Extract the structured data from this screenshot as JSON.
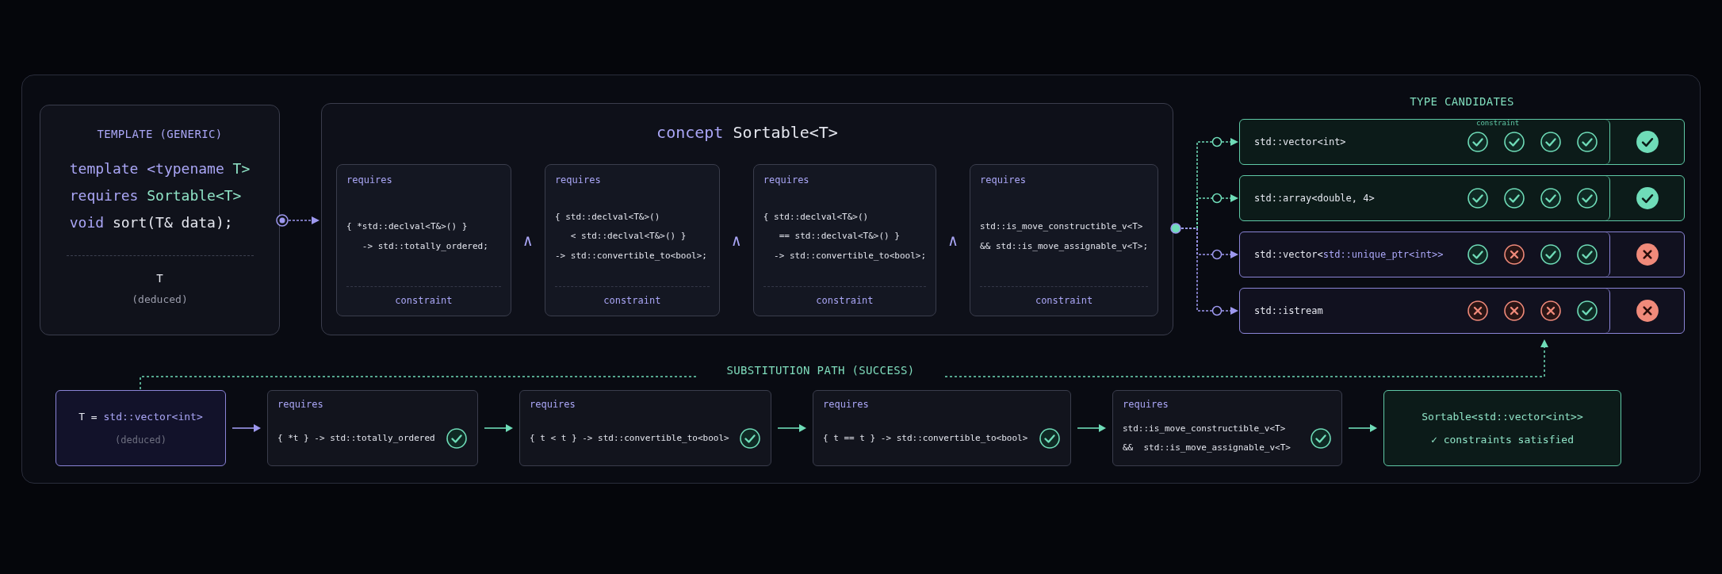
{
  "template": {
    "heading": "TEMPLATE (GENERIC)",
    "code_lines": [
      [
        {
          "text": "template <typename ",
          "kind": "keyword"
        },
        {
          "text": "T>",
          "kind": "type"
        }
      ],
      [
        {
          "text": "requires ",
          "kind": "keyword"
        },
        {
          "text": "Sortable<T>",
          "kind": "type"
        }
      ],
      [
        {
          "text": "void ",
          "kind": "keyword"
        },
        {
          "text": "sort(T& data);",
          "kind": "plain"
        }
      ]
    ],
    "param": "T",
    "param_note": "(deduced)"
  },
  "concept": {
    "title": [
      {
        "text": "concept ",
        "kind": "keyword"
      },
      {
        "text": "Sortable<T>",
        "kind": "plain"
      }
    ],
    "constraints": [
      {
        "label": "requires",
        "code": [
          "{ *std::declval<T&>() }",
          "   -> std::totally_ordered;"
        ],
        "footer": "constraint"
      },
      {
        "label": "requires",
        "code": [
          "{ std::declval<T&>()",
          "   < std::declval<T&>() }",
          "-> std::convertible_to<bool>;"
        ],
        "footer": "constraint"
      },
      {
        "label": "requires",
        "code": [
          "{ std::declval<T&>()",
          "   == std::declval<T&>() }",
          "  -> std::convertible_to<bool>;"
        ],
        "footer": "constraint"
      },
      {
        "label": "requires",
        "code": [
          "std::is_move_constructible_v<T>",
          "&& std::is_move_assignable_v<T>;"
        ],
        "footer": "constraint"
      }
    ],
    "joiners": [
      "∧",
      "∧",
      "∧"
    ]
  },
  "candidates": {
    "title": "TYPE CANDIDATES",
    "column_label": "constraint",
    "rows": [
      {
        "type": [
          {
            "text": "std::vector<int>",
            "kind": "plain"
          }
        ],
        "checks": [
          true,
          true,
          true,
          true
        ],
        "passed": true
      },
      {
        "type": [
          {
            "text": "std::array<double, 4>",
            "kind": "plain"
          }
        ],
        "checks": [
          true,
          true,
          true,
          true
        ],
        "passed": true
      },
      {
        "type": [
          {
            "text": "std::vector<",
            "kind": "plain"
          },
          {
            "text": "std::unique_ptr<int>>",
            "kind": "keyword"
          }
        ],
        "checks": [
          true,
          false,
          true,
          true
        ],
        "passed": false
      },
      {
        "type": [
          {
            "text": "std::istream",
            "kind": "plain"
          }
        ],
        "checks": [
          false,
          false,
          false,
          true
        ],
        "passed": false
      }
    ]
  },
  "substitution": {
    "label": "SUBSTITUTION PATH (SUCCESS)",
    "start": {
      "value": [
        {
          "text": "T = ",
          "kind": "plain"
        },
        {
          "text": "std::vector<int>",
          "kind": "keyword"
        }
      ],
      "note": "(deduced)"
    },
    "steps": [
      {
        "label": "requires",
        "code": [
          "{ *t } -> std::totally_ordered"
        ],
        "satisfied": true
      },
      {
        "label": "requires",
        "code": [
          "{ t < t } -> std::convertible_to<bool>"
        ],
        "satisfied": true
      },
      {
        "label": "requires",
        "code": [
          "{ t == t } -> std::convertible_to<bool>"
        ],
        "satisfied": true
      },
      {
        "label": "requires",
        "code": [
          "std::is_move_constructible_v<T>",
          "&&  std::is_move_assignable_v<T>"
        ],
        "satisfied": true
      }
    ],
    "result": {
      "title": "Sortable<std::vector<int>>",
      "status": "✓ constraints satisfied"
    }
  }
}
